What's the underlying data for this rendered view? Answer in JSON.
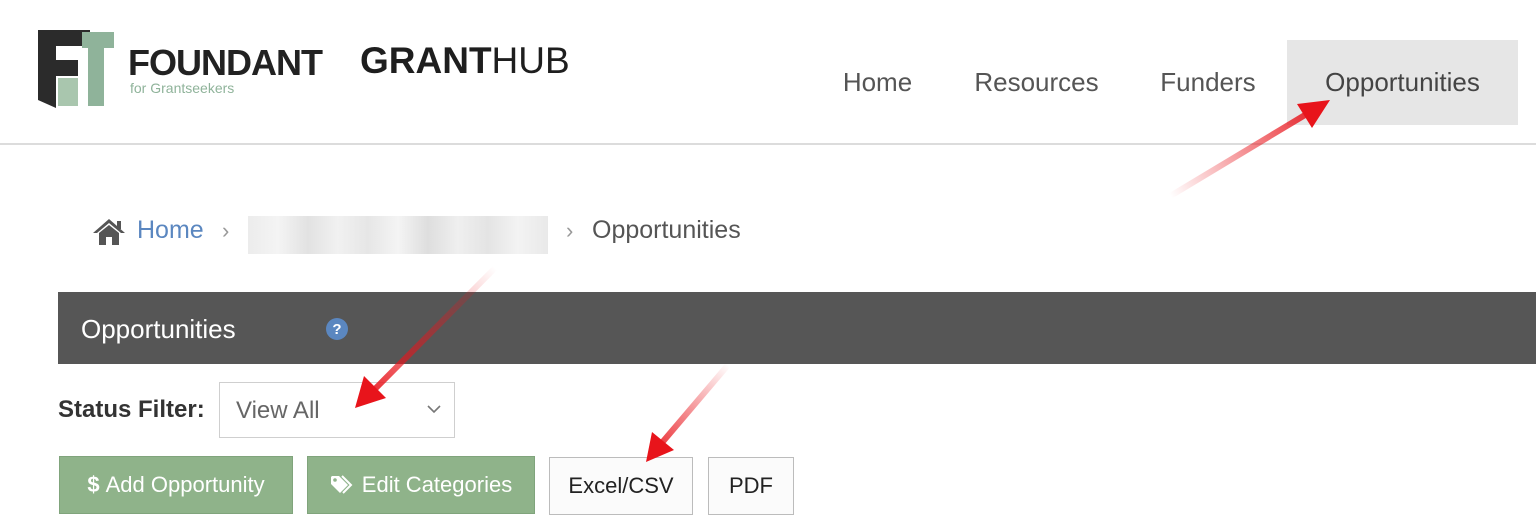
{
  "brand": {
    "wordmark": "FOUNDANT",
    "tagline": "for Grantseekers",
    "product_bold": "GRANT",
    "product_light": "HUB"
  },
  "nav": {
    "items": [
      {
        "label": "Home",
        "active": false
      },
      {
        "label": "Resources",
        "active": false
      },
      {
        "label": "Funders",
        "active": false
      },
      {
        "label": "Opportunities",
        "active": true
      }
    ]
  },
  "breadcrumb": {
    "home": "Home",
    "current": "Opportunities"
  },
  "panel": {
    "title": "Opportunities",
    "help_glyph": "?"
  },
  "filter": {
    "label": "Status Filter:",
    "value": "View All"
  },
  "buttons": {
    "add_opportunity": "Add Opportunity",
    "add_opportunity_glyph": "$",
    "edit_categories": "Edit Categories",
    "excel_csv": "Excel/CSV",
    "pdf": "PDF"
  },
  "colors": {
    "brand_green": "#8fb38a",
    "link_blue": "#5b87c0",
    "panel_gray": "#565656",
    "annotation_red": "#e8141b"
  }
}
